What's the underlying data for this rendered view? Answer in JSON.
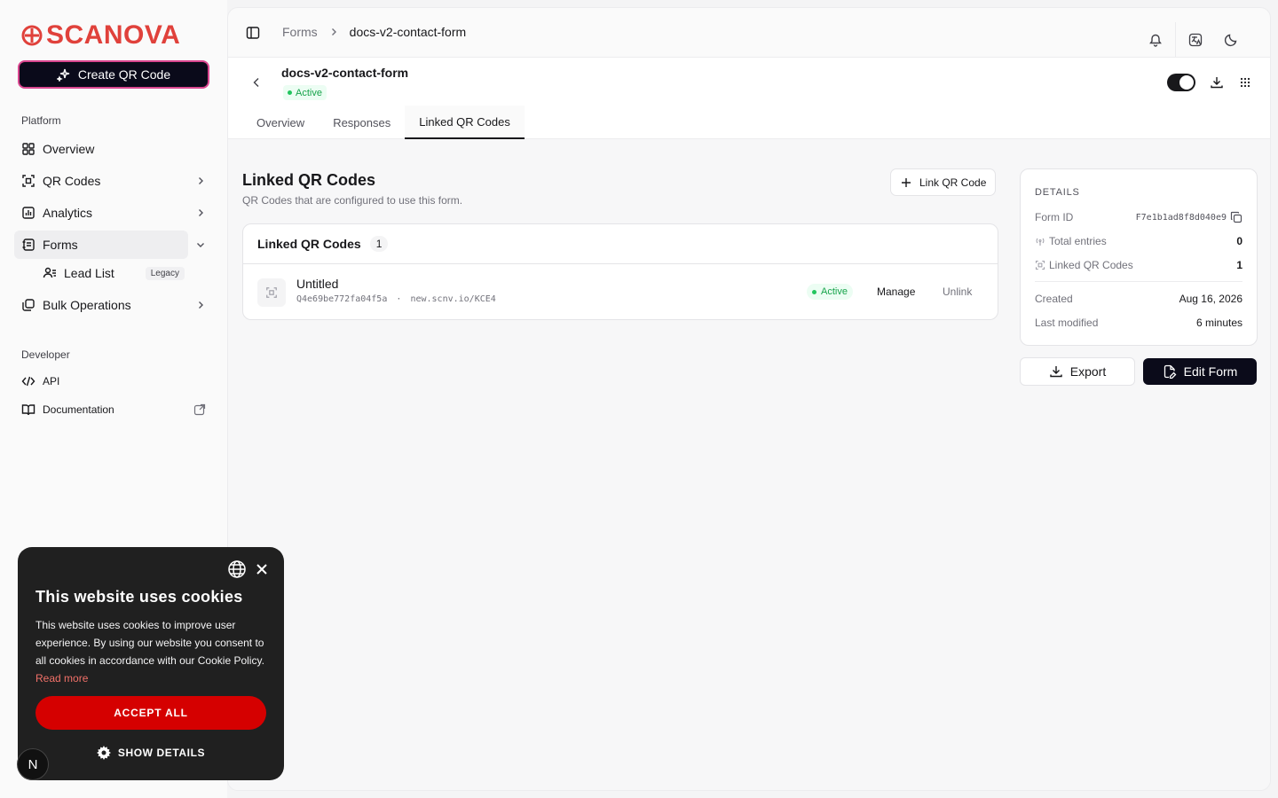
{
  "brand": {
    "name": "SCANOVA",
    "color": "#e0413b"
  },
  "sidebar": {
    "create_label": "Create QR Code",
    "platform_label": "Platform",
    "items": [
      {
        "label": "Overview",
        "icon": "grid-icon"
      },
      {
        "label": "QR Codes",
        "icon": "qr-scan-icon"
      },
      {
        "label": "Analytics",
        "icon": "chart-icon"
      },
      {
        "label": "Forms",
        "icon": "form-icon"
      },
      {
        "label": "Bulk Operations",
        "icon": "layers-icon"
      }
    ],
    "sub_item": {
      "label": "Lead List",
      "badge": "Legacy"
    },
    "developer_label": "Developer",
    "dev_items": [
      {
        "label": "API",
        "icon": "code-icon"
      },
      {
        "label": "Documentation",
        "icon": "book-icon"
      }
    ]
  },
  "breadcrumb": {
    "parent": "Forms",
    "current": "docs-v2-contact-form"
  },
  "form": {
    "title": "docs-v2-contact-form",
    "status": "Active",
    "tabs": [
      "Overview",
      "Responses",
      "Linked QR Codes"
    ],
    "active_tab": "Linked QR Codes"
  },
  "linked": {
    "title": "Linked QR Codes",
    "description": "QR Codes that are configured to use this form.",
    "link_button": "Link QR Code",
    "card_title": "Linked QR Codes",
    "count": "1",
    "rows": [
      {
        "title": "Untitled",
        "id": "Q4e69be772fa04f5a",
        "separator": "·",
        "url": "new.scnv.io/KCE4",
        "status": "Active",
        "manage": "Manage",
        "unlink": "Unlink"
      }
    ]
  },
  "details": {
    "label": "DETAILS",
    "form_id_label": "Form ID",
    "form_id": "F7e1b1ad8f8d040e9",
    "total_entries_label": "Total entries",
    "total_entries": "0",
    "linked_label": "Linked QR Codes",
    "linked_count": "1",
    "created_label": "Created",
    "created": "Aug 16, 2026",
    "modified_label": "Last modified",
    "modified": "6 minutes"
  },
  "actions": {
    "export": "Export",
    "edit": "Edit Form"
  },
  "cookie": {
    "title": "This website uses cookies",
    "text": "This website uses cookies to improve user experience. By using our website you consent to all cookies in accordance with our Cookie Policy.",
    "read_more": "Read more",
    "accept": "ACCEPT ALL",
    "show_details": "SHOW DETAILS",
    "accent": "#d50000"
  },
  "badge": {
    "letter": "N"
  }
}
